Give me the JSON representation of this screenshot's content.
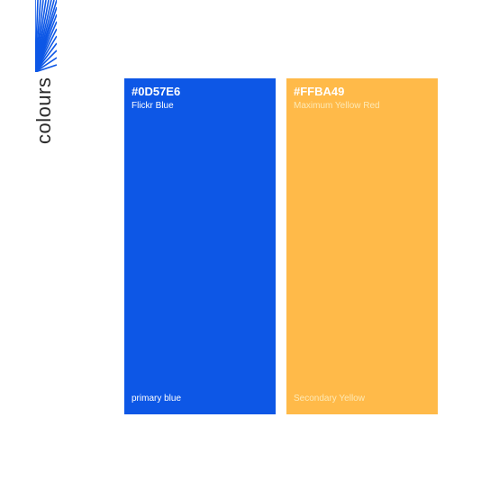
{
  "brand": {
    "title": "colours",
    "accent_color": "#0D57E6",
    "logo_icon": "sunburst-lines-icon"
  },
  "swatches": [
    {
      "hex": "#0D57E6",
      "name": "Flickr Blue",
      "role": "primary blue",
      "color": "#0D57E6"
    },
    {
      "hex": "#FFBA49",
      "name": "Maximum Yellow Red",
      "role": "Secondary Yellow",
      "color": "#FFBA49"
    }
  ]
}
